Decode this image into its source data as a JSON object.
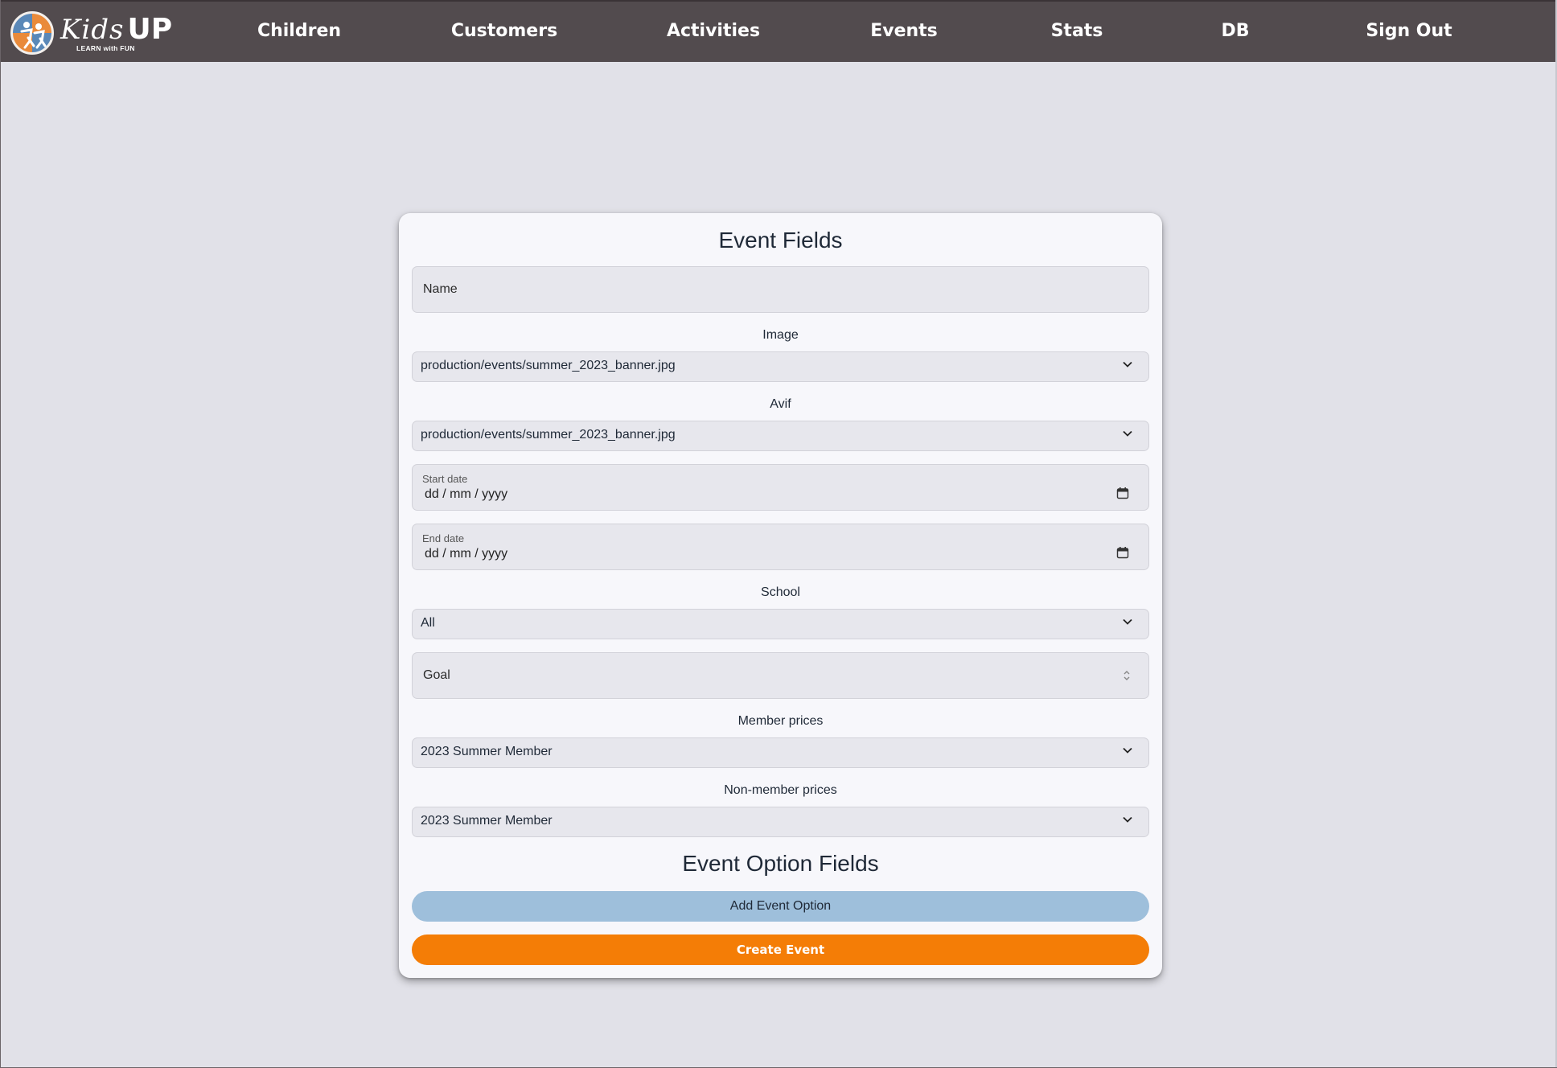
{
  "brand": {
    "word_kids": "Kids",
    "word_up": "UP",
    "tagline": "LEARN with FUN"
  },
  "nav": {
    "items": [
      {
        "label": "Children"
      },
      {
        "label": "Customers"
      },
      {
        "label": "Activities"
      },
      {
        "label": "Events"
      },
      {
        "label": "Stats"
      },
      {
        "label": "DB"
      },
      {
        "label": "Sign Out"
      }
    ]
  },
  "form": {
    "title": "Event Fields",
    "name": {
      "placeholder": "Name"
    },
    "image": {
      "label": "Image",
      "selected": "production/events/summer_2023_banner.jpg"
    },
    "avif": {
      "label": "Avif",
      "selected": "production/events/summer_2023_banner.jpg"
    },
    "start_date": {
      "label": "Start date",
      "value": "dd / mm / yyyy"
    },
    "end_date": {
      "label": "End date",
      "value": "dd / mm / yyyy"
    },
    "school": {
      "label": "School",
      "selected": "All"
    },
    "goal": {
      "placeholder": "Goal"
    },
    "member_prices": {
      "label": "Member prices",
      "selected": "2023 Summer Member"
    },
    "non_member_prices": {
      "label": "Non-member prices",
      "selected": "2023 Summer Member"
    },
    "options_title": "Event Option Fields",
    "add_option_label": "Add Event Option",
    "create_label": "Create Event"
  },
  "colors": {
    "nav_bg": "#524b4e",
    "page_bg": "#e1e1e8",
    "card_bg": "#f7f7fb",
    "add_button": "#9ebfdb",
    "create_button": "#f47d06"
  }
}
